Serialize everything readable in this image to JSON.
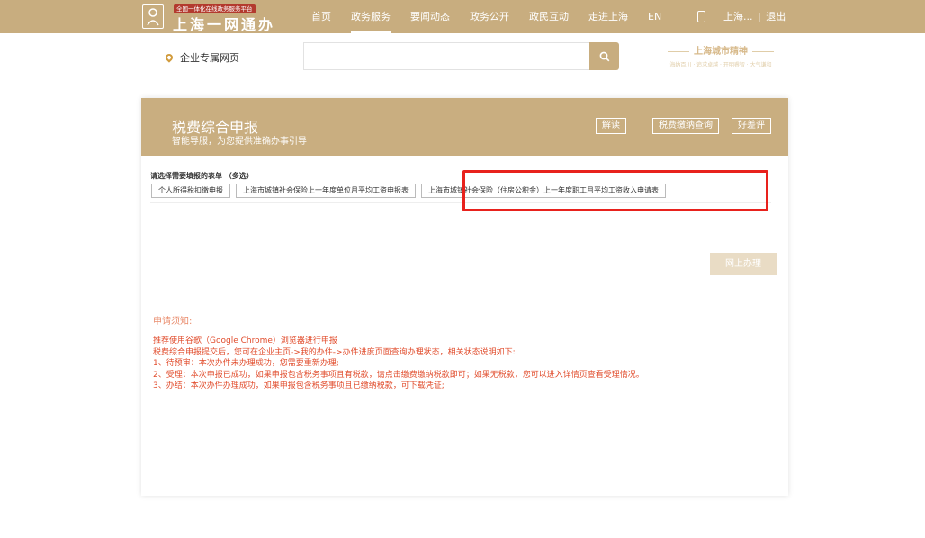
{
  "header": {
    "badge": "全国一体化在线政务服务平台",
    "logo_text": "上海一网通办",
    "nav": [
      {
        "label": "首页",
        "active": false
      },
      {
        "label": "政务服务",
        "active": true
      },
      {
        "label": "要闻动态",
        "active": false
      },
      {
        "label": "政务公开",
        "active": false
      },
      {
        "label": "政民互动",
        "active": false
      },
      {
        "label": "走进上海",
        "active": false
      },
      {
        "label": "EN",
        "active": false
      }
    ],
    "user": "上海...",
    "separator": "|",
    "logout": "退出"
  },
  "subheader": {
    "location": "企业专属网页",
    "search_placeholder": "",
    "spirit_title": "上海城市精神",
    "spirit_sub": "海纳百川 · 追求卓越 · 开明睿智 · 大气谦和"
  },
  "card": {
    "title": "税费综合申报",
    "subtitle": "智能导服，为您提供准确办事引导",
    "header_buttons": [
      "解读",
      "税费缴纳查询",
      "好差评"
    ],
    "select_label": "请选择需要填报的表单 （多选）",
    "forms": [
      "个人所得税扣缴申报",
      "上海市城镇社会保险上一年度单位月平均工资申报表",
      "上海市城镇社会保险（住房公积金）上一年度职工月平均工资收入申请表"
    ],
    "go_button": "网上办理",
    "notice_title": "申请须知:",
    "notice_lines": [
      "推荐使用谷歌（Google Chrome）浏览器进行申报",
      "税费综合申报提交后，您可在企业主页->我的办件->办件进度页面查询办理状态，相关状态说明如下:",
      "1、待预审：本次办件未办理成功，您需要重新办理;",
      "2、受理：本次申报已成功，如果申报包含税务事项且有税款，请点击缴费缴纳税款即可；如果无税款，您可以进入详情页查看受理情况。",
      "3、办结：本次办件办理成功，如果申报包含税务事项且已缴纳税款，可下载凭证;"
    ]
  },
  "colors": {
    "brand": "#c8ad7f",
    "highlight": "#e8221d",
    "notice": "#e14c2c"
  }
}
